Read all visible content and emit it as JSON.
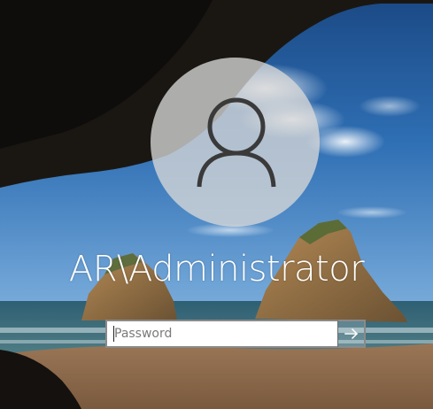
{
  "login": {
    "username": "AR\\Administrator",
    "password_placeholder": "Password",
    "password_value": "",
    "submit_icon": "arrow-right-icon"
  },
  "avatar": {
    "icon": "user-icon"
  },
  "colors": {
    "text": "#ffffff",
    "avatar_bg": "#d7d7d7",
    "avatar_glyph": "#3a3a3a",
    "input_border": "#8a8a8a"
  }
}
